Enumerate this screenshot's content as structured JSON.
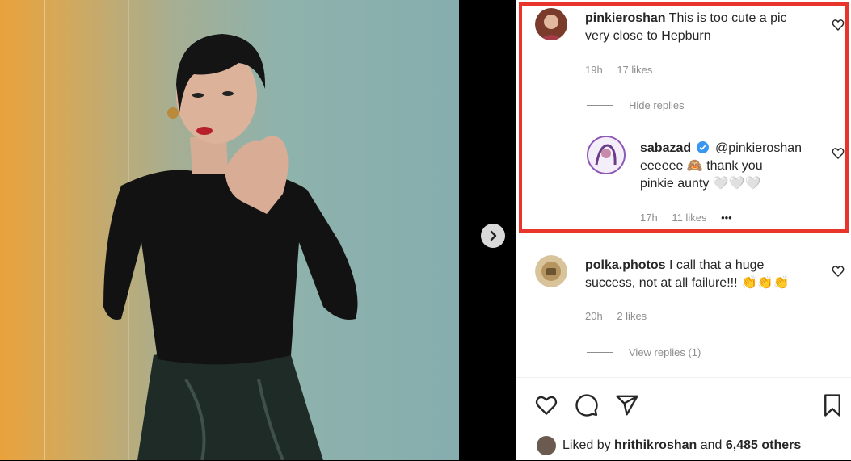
{
  "comments": [
    {
      "username": "pinkieroshan",
      "text_line1": "This is too cute a pic",
      "text_line2": "very close to Hepburn",
      "time": "19h",
      "likes": "17 likes",
      "replies_toggle": "Hide replies"
    },
    {
      "username": "sabazad",
      "mention": "@pinkieroshan",
      "text_line2": "eeeeee 🙈 thank you",
      "text_line3": "pinkie aunty 🤍🤍🤍",
      "time": "17h",
      "likes": "11 likes",
      "more": "•••",
      "verified": true
    },
    {
      "username": "polka.photos",
      "text_line1": "I call that a huge",
      "text_line2": "success, not at all failure!!! 👏👏👏",
      "time": "20h",
      "likes": "2 likes",
      "replies_toggle": "View replies (1)"
    }
  ],
  "liked_by": {
    "prefix": "Liked by",
    "user": "hrithikroshan",
    "middle": "and",
    "count": "6,485 others"
  },
  "colors": {
    "highlight": "#e8342a",
    "verified": "#3897f0",
    "muted": "#8e8e8e"
  },
  "icons": [
    "heart-icon",
    "comment-icon",
    "share-icon",
    "bookmark-icon",
    "chevron-right-icon",
    "verified-icon"
  ]
}
